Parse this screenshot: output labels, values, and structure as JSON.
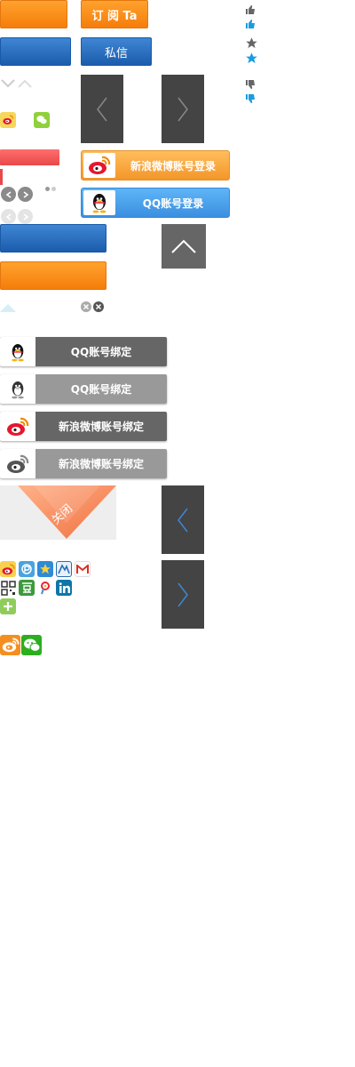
{
  "buttons": {
    "subscribe_label": "订 阅 Ta",
    "message_label": "私信"
  },
  "login": {
    "weibo_label": "新浪微博账号登录",
    "qq_label": "QQ账号登录"
  },
  "bind": {
    "qq_dark_label": "QQ账号绑定",
    "qq_light_label": "QQ账号绑定",
    "weibo_dark_label": "新浪微博账号绑定",
    "weibo_light_label": "新浪微博账号绑定"
  },
  "close_ribbon": {
    "label": "关闭"
  },
  "share_icons": {
    "row1": [
      "weibo-icon",
      "qzone-icon",
      "star-icon",
      "renren-icon",
      "gmail-icon"
    ],
    "row2": [
      "qrcode-icon",
      "douban-icon",
      "tqq-icon",
      "linkedin-icon"
    ],
    "row3": [
      "more-icon"
    ]
  },
  "colors": {
    "orange": "#f8901f",
    "blue": "#1f63b5",
    "dark_panel": "#444444",
    "star_active": "#1a9ce0",
    "bind_dark": "#666666",
    "bind_light": "#999999"
  }
}
